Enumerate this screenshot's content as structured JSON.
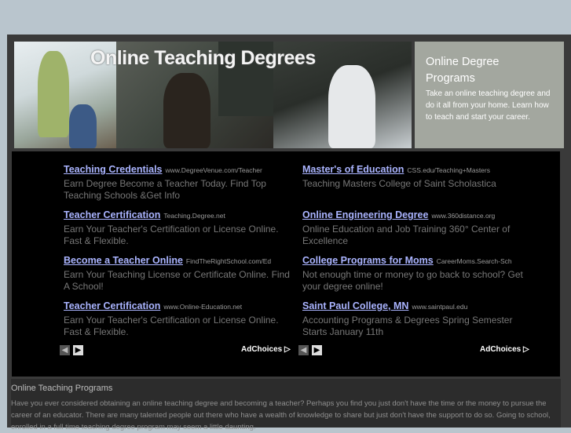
{
  "banner": {
    "title": "Online Teaching Degrees"
  },
  "sidebox": {
    "title": "Online Degree Programs",
    "text": "Take an online teaching degree and do it all from your home. Learn how to teach and start your career."
  },
  "ads_left": [
    {
      "title": "Teaching Credentials",
      "url": "www.DegreeVenue.com/Teacher",
      "desc": "Earn Degree Become a Teacher Today. Find Top Teaching Schools &Get Info"
    },
    {
      "title": "Teacher Certification",
      "url": "Teaching.Degree.net",
      "desc": "Earn Your Teacher's Certification or License Online. Fast & Flexible."
    },
    {
      "title": "Become a Teacher Online",
      "url": "FindTheRightSchool.com/Ed",
      "desc": "Earn Your Teaching License or Certificate Online. Find A School!"
    },
    {
      "title": "Teacher Certification",
      "url": "www.Online-Education.net",
      "desc": "Earn Your Teacher's Certification or License Online. Fast & Flexible."
    }
  ],
  "ads_right": [
    {
      "title": "Master's of Education",
      "url": "CSS.edu/Teaching+Masters",
      "desc": "Teaching Masters College of Saint Scholastica"
    },
    {
      "title": "Online Engineering Degree",
      "url": "www.360distance.org",
      "desc": "Online Education and Job Training 360° Center of Excellence"
    },
    {
      "title": "College Programs for Moms",
      "url": "CareerMoms.Search-Sch",
      "desc": "Not enough time or money to go back to school? Get your degree online!"
    },
    {
      "title": "Saint Paul College, MN",
      "url": "www.saintpaul.edu",
      "desc": "Accounting Programs & Degrees Spring Semester Starts January 11th"
    }
  ],
  "adnav": {
    "prev": "◀",
    "next": "▶",
    "adchoices": "AdChoices ▷"
  },
  "article": {
    "heading": "Online Teaching Programs",
    "text": "Have you ever considered obtaining an online teaching degree and becoming a teacher? Perhaps you find you just don't have the time or the money to pursue the career of an educator. There are many talented people out there who have a wealth of knowledge to share but just don't have the support to do so. Going to school, enrolled in a full time teaching degree program may seem a little daunting."
  }
}
